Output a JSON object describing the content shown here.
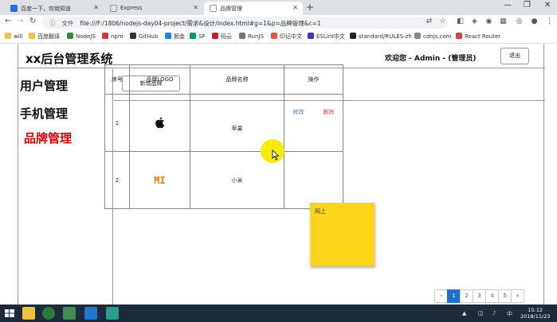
{
  "browser": {
    "tabs": [
      {
        "label": "百度一下，你就知道",
        "favicon_color": "#2f6ae6"
      },
      {
        "label": "Express",
        "favicon_color": "#cccccc"
      },
      {
        "label": "品牌管理",
        "favicon_color": "#cccccc"
      }
    ],
    "address_label": "文件",
    "url": "file:///F:/1806/nodejs-day04-project/需求&设计/index.html#g=1&p=品牌管理&c=1",
    "bookmarks": [
      "will",
      "百度翻译",
      "NodeJS",
      "npm",
      "GitHub",
      "掘金",
      "SF",
      "码云",
      "RunJS",
      "印记中文",
      "ESLint中文",
      "standard/RULES-zh",
      "cdnjs.com",
      "React Router"
    ]
  },
  "app": {
    "title": "xx后台管理系统",
    "welcome": "欢迎您 - Admin - (管理员)",
    "logout_label": "退出"
  },
  "sidebar": {
    "items": [
      {
        "label": "用户管理",
        "active": false
      },
      {
        "label": "手机管理",
        "active": false
      },
      {
        "label": "品牌管理",
        "active": true
      }
    ]
  },
  "actions": {
    "add_label": "新增品牌"
  },
  "table": {
    "headers": [
      "序号",
      "品牌LOGO",
      "品牌名称",
      "操作"
    ],
    "rows": [
      {
        "index": "1",
        "logo_icon": "apple-logo",
        "name": "苹果",
        "edit": "修改",
        "delete": "删除"
      },
      {
        "index": "2",
        "logo_icon": "mi-logo",
        "name": "小米",
        "edit": "",
        "delete": ""
      }
    ]
  },
  "sticky_note": {
    "text": "网上"
  },
  "pagination": {
    "prev": "«",
    "pages": [
      "1",
      "2",
      "3",
      "4",
      "5"
    ],
    "current": "1",
    "next": "»"
  },
  "taskbar": {
    "time": "15:12",
    "date": "2018/11/23"
  }
}
